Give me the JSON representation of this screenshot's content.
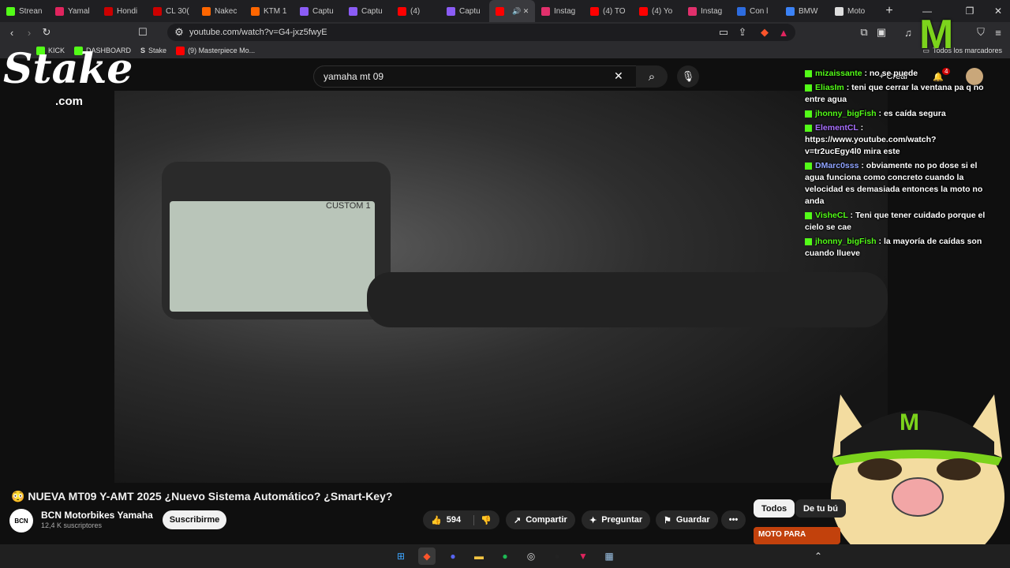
{
  "browser": {
    "tabs": [
      {
        "label": "Strean",
        "color": "#53fc18"
      },
      {
        "label": "Yamal",
        "color": "#e0245e"
      },
      {
        "label": "Hondi",
        "color": "#cc0000"
      },
      {
        "label": "CL 30(",
        "color": "#cc0000"
      },
      {
        "label": "Nakec",
        "color": "#ff6600"
      },
      {
        "label": "KTM 1",
        "color": "#ff6600"
      },
      {
        "label": "Captu",
        "color": "#8b5cf6"
      },
      {
        "label": "Captu",
        "color": "#8b5cf6"
      },
      {
        "label": "(4)",
        "color": "#ff0000"
      },
      {
        "label": "Captu",
        "color": "#8b5cf6"
      },
      {
        "label": "",
        "color": "#ff0000",
        "active": true
      },
      {
        "label": "Instag",
        "color": "#e1306c"
      },
      {
        "label": "(4) TO",
        "color": "#ff0000"
      },
      {
        "label": "(4) Yo",
        "color": "#ff0000"
      },
      {
        "label": "Instag",
        "color": "#e1306c"
      },
      {
        "label": "Con l",
        "color": "#2d6cdf"
      },
      {
        "label": "BMW",
        "color": "#3b82f6"
      },
      {
        "label": "Moto",
        "color": "#dddddd"
      }
    ],
    "url": "youtube.com/watch?v=G4-jxz5fwyE",
    "bookmarks": [
      {
        "label": "KICK"
      },
      {
        "label": "DASHBOARD"
      },
      {
        "label": "Stake"
      },
      {
        "label": "(9) Masterpiece Mo..."
      }
    ],
    "bookmarks_right": "Todos los marcadores"
  },
  "overlay": {
    "stake_logo": "Stake",
    "stake_com": ".com",
    "monster_logo": "M"
  },
  "youtube": {
    "search_value": "yamaha mt 09",
    "notification_count": "4",
    "crear_label": "+ Crear",
    "video_screen_label": "CUSTOM 1",
    "title": "NUEVA MT09 Y-AMT 2025 ¿Nuevo Sistema Automático? ¿Smart-Key?",
    "channel": "BCN Motorbikes Yamaha",
    "channel_avatar": "BCN",
    "subscribers": "12,4 K suscriptores",
    "subscribe_label": "Suscribirme",
    "likes": "594",
    "share_label": "Compartir",
    "ask_label": "Preguntar",
    "save_label": "Guardar",
    "more_label": "•••",
    "chip_all": "Todos",
    "chip_search": "De tu bú",
    "rec_thumb": "MOTO PARA"
  },
  "chat": [
    {
      "user": "mizaissante",
      "color": "#53fc18",
      "msg": "no se puede"
    },
    {
      "user": "EliasIm",
      "color": "#53fc18",
      "msg": "teni que cerrar la ventana pa q no entre agua"
    },
    {
      "user": "jhonny_bigFish",
      "color": "#53fc18",
      "msg": "es caída segura"
    },
    {
      "user": "ElementCL",
      "color": "#a970ff",
      "msg": "https://www.youtube.com/watch?v=tr2ucEgy4l0 mira este"
    },
    {
      "user": "DMarc0sss",
      "color": "#8fa3ff",
      "msg": "obviamente no po dose si el agua funciona como concreto cuando la velocidad es demasiada entonces la moto no anda"
    },
    {
      "user": "VisheCL",
      "color": "#53fc18",
      "msg": "Teni que tener cuidado porque el cielo se cae"
    },
    {
      "user": "jhonny_bigFish",
      "color": "#53fc18",
      "msg": "la mayoría de caídas son cuando llueve"
    }
  ]
}
